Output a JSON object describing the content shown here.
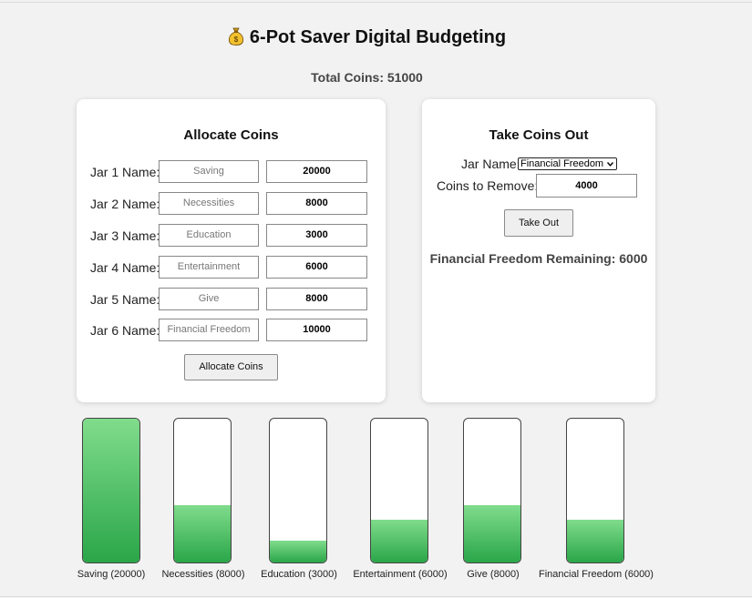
{
  "header": {
    "title": "6-Pot Saver Digital Budgeting",
    "total_label": "Total Coins: 51000"
  },
  "allocate": {
    "heading": "Allocate Coins",
    "button_label": "Allocate Coins",
    "jars": [
      {
        "label": "Jar 1 Name:",
        "name": "Saving",
        "amount": "20000"
      },
      {
        "label": "Jar 2 Name:",
        "name": "Necessities",
        "amount": "8000"
      },
      {
        "label": "Jar 3 Name:",
        "name": "Education",
        "amount": "3000"
      },
      {
        "label": "Jar 4 Name:",
        "name": "Entertainment",
        "amount": "6000"
      },
      {
        "label": "Jar 5 Name:",
        "name": "Give",
        "amount": "8000"
      },
      {
        "label": "Jar 6 Name:",
        "name": "Financial Freedom",
        "amount": "10000"
      }
    ]
  },
  "take": {
    "heading": "Take Coins Out",
    "jar_label": "Jar Name:",
    "selected_jar": "Financial Freedom",
    "remove_label": "Coins to Remove:",
    "remove_value": "4000",
    "button_label": "Take Out",
    "remaining_text": "Financial Freedom Remaining: 6000"
  },
  "jars_display": [
    {
      "caption": "Saving (20000)",
      "fill_fraction": 1.0
    },
    {
      "caption": "Necessities (8000)",
      "fill_fraction": 0.4
    },
    {
      "caption": "Education (3000)",
      "fill_fraction": 0.15
    },
    {
      "caption": "Entertainment (6000)",
      "fill_fraction": 0.3
    },
    {
      "caption": "Give (8000)",
      "fill_fraction": 0.4
    },
    {
      "caption": "Financial Freedom (6000)",
      "fill_fraction": 0.3
    }
  ],
  "colors": {
    "jar_fill_top": "#80dc8c",
    "jar_fill_bottom": "#2aa648",
    "background": "#f2f2f2"
  },
  "icons": {
    "title_icon": "money-bag-icon"
  }
}
